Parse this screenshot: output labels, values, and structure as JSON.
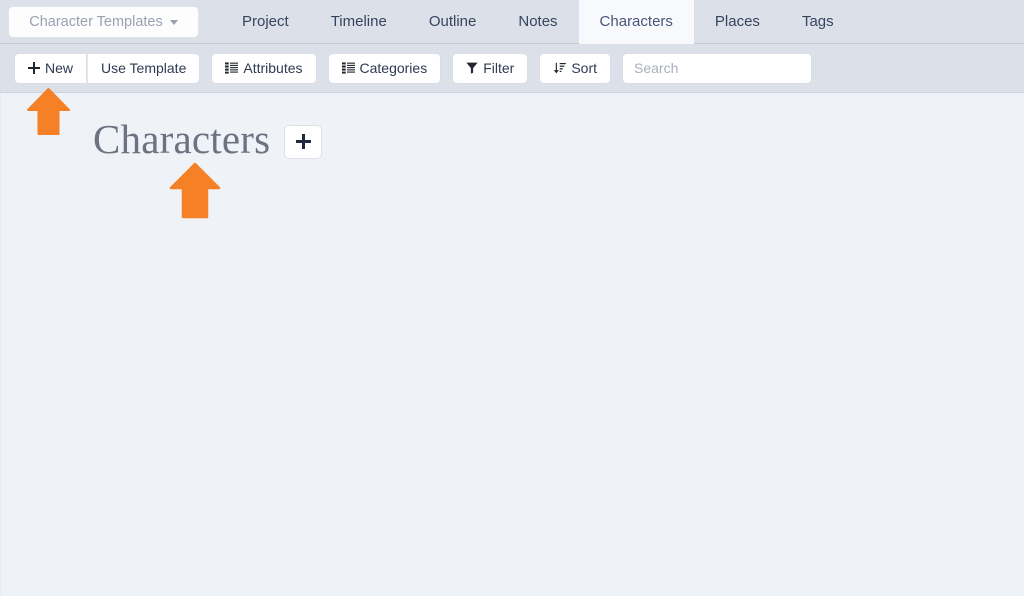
{
  "topbar": {
    "templates_button": {
      "label": "Character Templates",
      "icon": "chevron-down-icon"
    },
    "tabs": [
      {
        "label": "Project",
        "active": false
      },
      {
        "label": "Timeline",
        "active": false
      },
      {
        "label": "Outline",
        "active": false
      },
      {
        "label": "Notes",
        "active": false
      },
      {
        "label": "Characters",
        "active": true
      },
      {
        "label": "Places",
        "active": false
      },
      {
        "label": "Tags",
        "active": false
      }
    ]
  },
  "toolbar": {
    "new_label": "New",
    "new_icon": "plus-icon",
    "use_template_label": "Use Template",
    "attributes_label": "Attributes",
    "attributes_icon": "list-icon",
    "categories_label": "Categories",
    "categories_icon": "list-icon",
    "filter_label": "Filter",
    "filter_icon": "funnel-icon",
    "sort_label": "Sort",
    "sort_icon": "sort-amount-down-icon",
    "search_placeholder": "Search",
    "search_value": ""
  },
  "main": {
    "page_title": "Characters",
    "add_button_icon": "plus-icon",
    "add_button_label": ""
  },
  "annotations": [
    {
      "name": "arrow-pointing-to-new-button",
      "icon": "up-arrow-icon",
      "color": "#f58025"
    },
    {
      "name": "arrow-pointing-to-page-title",
      "icon": "up-arrow-icon",
      "color": "#f58025"
    }
  ],
  "colors": {
    "chrome_bg": "#dce1e9",
    "content_bg": "#eff2f7",
    "active_tab_bg": "#f7f9fc",
    "accent_orange": "#f58025",
    "text": "#2f3b52",
    "muted_text": "#9aa2b0",
    "title_text": "#6c7280"
  }
}
